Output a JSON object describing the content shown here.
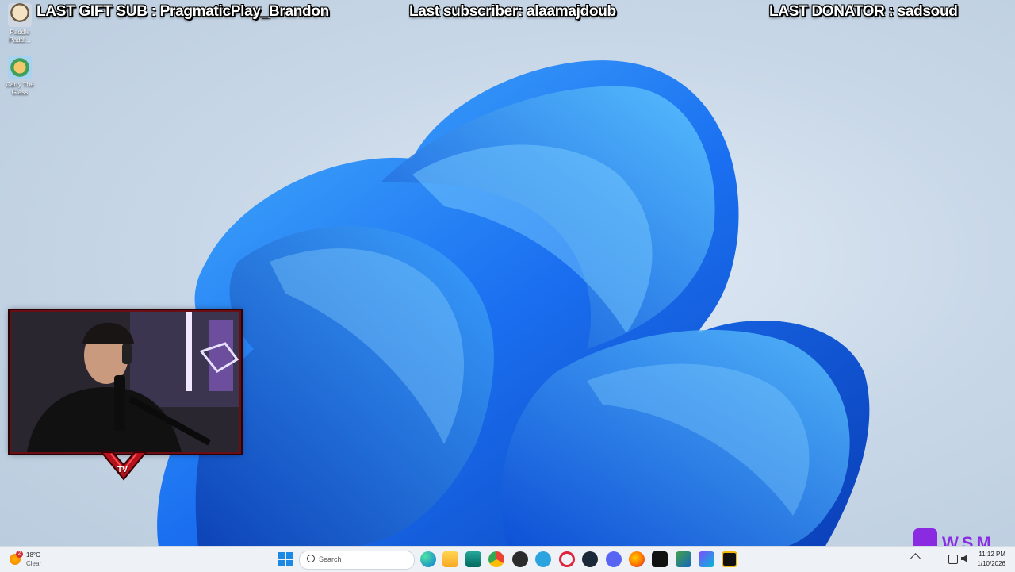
{
  "overlay": {
    "last_gift_sub": "LAST GIFT SUB : PragmaticPlay_Brandon",
    "last_subscriber": "Last subscriber: alaamajdoub",
    "last_donator": "LAST DONATOR : sadsoud"
  },
  "desktop_icons": [
    {
      "label": "Paddle Paddl..."
    },
    {
      "label": "Carry The Glass"
    }
  ],
  "weather": {
    "temp": "18°C",
    "condition": "Clear",
    "badge": "2"
  },
  "taskbar": {
    "search_placeholder": "Search"
  },
  "clock": {
    "time": "11:12 PM",
    "date": "1/10/2026"
  },
  "brand": {
    "wsm": "WSM",
    "stream_logo": "TV"
  }
}
